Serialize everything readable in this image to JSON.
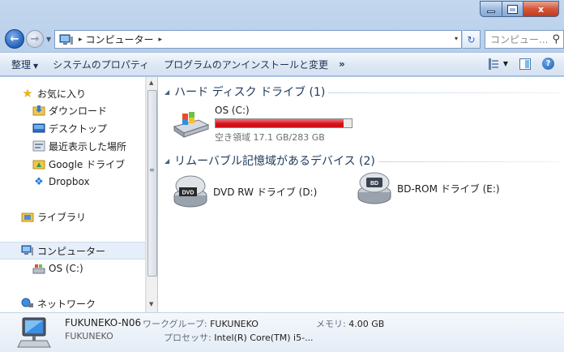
{
  "window": {
    "minimize_icon": "minimize-icon",
    "maximize_icon": "maximize-icon",
    "close_glyph": "x"
  },
  "address_bar": {
    "path_label": "コンピューター",
    "separator": "▸",
    "dropdown": "▾",
    "refresh_glyph": "↻"
  },
  "search": {
    "placeholder": "コンピュー...",
    "icon": "search-icon"
  },
  "toolbar": {
    "organize": "整理",
    "system_properties": "システムのプロパティ",
    "uninstall": "プログラムのアンインストールと変更",
    "more": "»",
    "help_glyph": "?"
  },
  "nav": {
    "favorites": "お気に入り",
    "downloads": "ダウンロード",
    "desktop": "デスクトップ",
    "recent": "最近表示した場所",
    "google_drive": "Google ドライブ",
    "dropbox": "Dropbox",
    "libraries": "ライブラリ",
    "computer": "コンピューター",
    "os_drive": "OS (C:)",
    "network": "ネットワーク"
  },
  "groups": {
    "hdd_header": "ハード ディスク ドライブ (1)",
    "removable_header": "リムーバブル記憶域があるデバイス (2)"
  },
  "drives": {
    "os": {
      "label": "OS (C:)",
      "free_text": "空き領域 17.1 GB/283 GB",
      "used_fraction": 0.94,
      "bar_color": "#d8101a"
    },
    "dvd": {
      "label": "DVD RW ドライブ (D:)",
      "badge": "DVD"
    },
    "bd": {
      "label": "BD-ROM ドライブ (E:)",
      "badge": "BD"
    }
  },
  "details": {
    "computer_name": "FUKUNEKO-N06",
    "workgroup_key": "ワークグループ:",
    "workgroup_value": "FUKUNEKO",
    "memory_key": "メモリ:",
    "memory_value": "4.00 GB",
    "sub_name": "FUKUNEKO",
    "processor_key": "プロセッサ:",
    "processor_value": "Intel(R) Core(TM) i5-..."
  }
}
